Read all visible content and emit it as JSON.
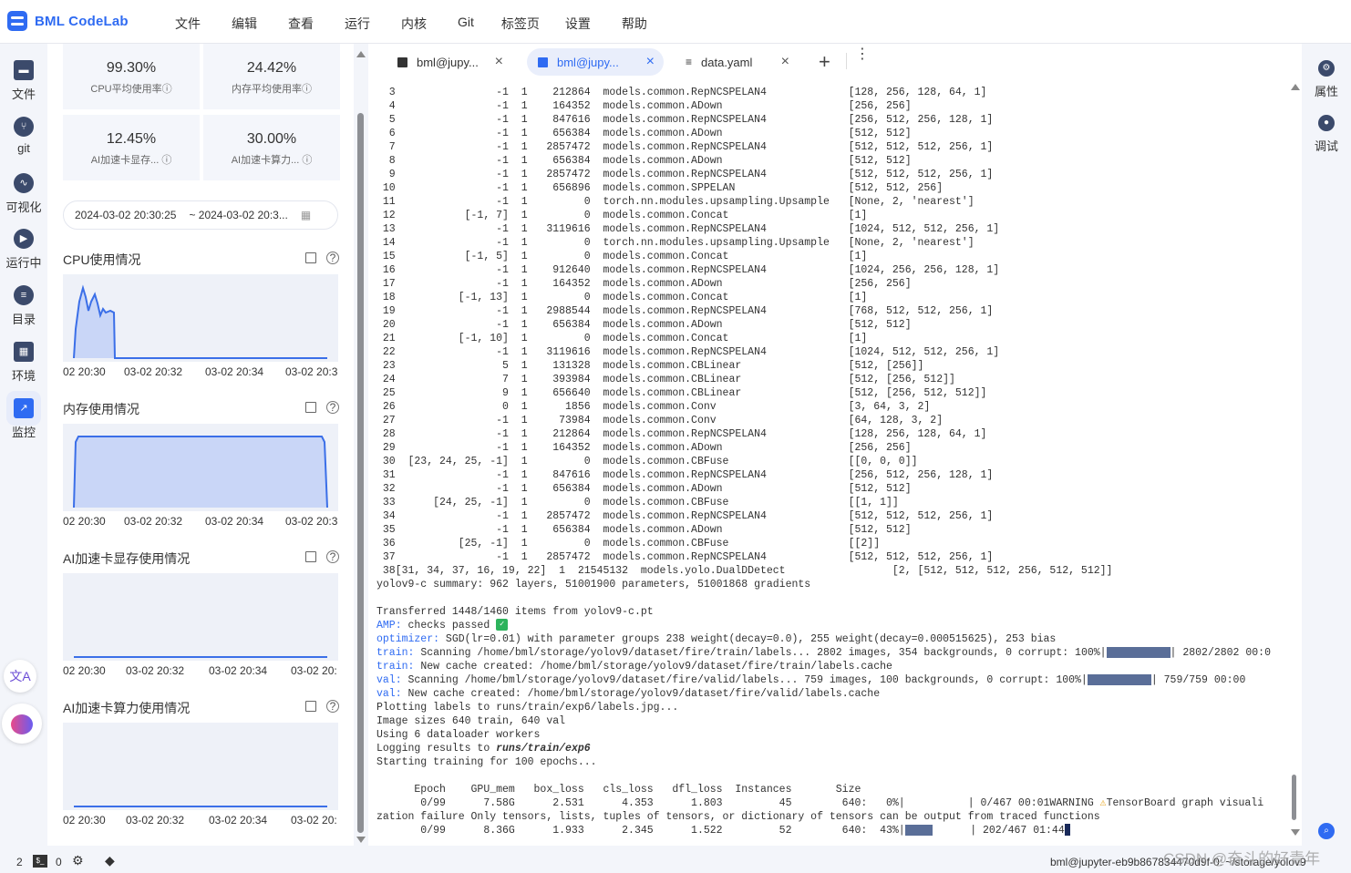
{
  "app": {
    "name": "BML CodeLab"
  },
  "menu": [
    "文件",
    "编辑",
    "查看",
    "运行",
    "内核",
    "Git",
    "标签页",
    "设置",
    "帮助"
  ],
  "activity": [
    {
      "label": "文件",
      "icon": "folder-icon"
    },
    {
      "label": "git",
      "icon": "git-icon"
    },
    {
      "label": "可视化",
      "icon": "visualize-icon"
    },
    {
      "label": "运行中",
      "icon": "running-icon"
    },
    {
      "label": "目录",
      "icon": "toc-icon"
    },
    {
      "label": "环境",
      "icon": "environment-icon"
    },
    {
      "label": "监控",
      "icon": "monitor-icon"
    }
  ],
  "monitor": {
    "stats": [
      {
        "value": "99.30%",
        "label": "CPU平均使用率"
      },
      {
        "value": "24.42%",
        "label": "内存平均使用率"
      },
      {
        "value": "12.45%",
        "label": "AI加速卡显存..."
      },
      {
        "value": "30.00%",
        "label": "AI加速卡算力..."
      }
    ],
    "date_start": "2024-03-02 20:30:25",
    "date_end": "~ 2024-03-02 20:3...",
    "charts": [
      {
        "title": "CPU使用情况",
        "ticks": [
          "02 20:30",
          "03-02 20:32",
          "03-02 20:34",
          "03-02 20:3"
        ]
      },
      {
        "title": "内存使用情况",
        "ticks": [
          "02 20:30",
          "03-02 20:32",
          "03-02 20:34",
          "03-02 20:3"
        ]
      },
      {
        "title": "AI加速卡显存使用情况",
        "ticks": [
          "02 20:30",
          "03-02 20:32",
          "03-02 20:34",
          "03-02 20:"
        ]
      },
      {
        "title": "AI加速卡算力使用情况",
        "ticks": [
          "02 20:30",
          "03-02 20:32",
          "03-02 20:34",
          "03-02 20:"
        ]
      }
    ]
  },
  "tabs": [
    {
      "label": "bml@jupy...",
      "active": false
    },
    {
      "label": "bml@jupy...",
      "active": true
    },
    {
      "label": "data.yaml",
      "active": false
    }
  ],
  "terminal": {
    "model_rows": [
      [
        "3",
        "-1",
        "1",
        "212864",
        "models.common.RepNCSPELAN4",
        "[128, 256, 128, 64, 1]"
      ],
      [
        "4",
        "-1",
        "1",
        "164352",
        "models.common.ADown",
        "[256, 256]"
      ],
      [
        "5",
        "-1",
        "1",
        "847616",
        "models.common.RepNCSPELAN4",
        "[256, 512, 256, 128, 1]"
      ],
      [
        "6",
        "-1",
        "1",
        "656384",
        "models.common.ADown",
        "[512, 512]"
      ],
      [
        "7",
        "-1",
        "1",
        "2857472",
        "models.common.RepNCSPELAN4",
        "[512, 512, 512, 256, 1]"
      ],
      [
        "8",
        "-1",
        "1",
        "656384",
        "models.common.ADown",
        "[512, 512]"
      ],
      [
        "9",
        "-1",
        "1",
        "2857472",
        "models.common.RepNCSPELAN4",
        "[512, 512, 512, 256, 1]"
      ],
      [
        "10",
        "-1",
        "1",
        "656896",
        "models.common.SPPELAN",
        "[512, 512, 256]"
      ],
      [
        "11",
        "-1",
        "1",
        "0",
        "torch.nn.modules.upsampling.Upsample",
        "[None, 2, 'nearest']"
      ],
      [
        "12",
        "[-1, 7]",
        "1",
        "0",
        "models.common.Concat",
        "[1]"
      ],
      [
        "13",
        "-1",
        "1",
        "3119616",
        "models.common.RepNCSPELAN4",
        "[1024, 512, 512, 256, 1]"
      ],
      [
        "14",
        "-1",
        "1",
        "0",
        "torch.nn.modules.upsampling.Upsample",
        "[None, 2, 'nearest']"
      ],
      [
        "15",
        "[-1, 5]",
        "1",
        "0",
        "models.common.Concat",
        "[1]"
      ],
      [
        "16",
        "-1",
        "1",
        "912640",
        "models.common.RepNCSPELAN4",
        "[1024, 256, 256, 128, 1]"
      ],
      [
        "17",
        "-1",
        "1",
        "164352",
        "models.common.ADown",
        "[256, 256]"
      ],
      [
        "18",
        "[-1, 13]",
        "1",
        "0",
        "models.common.Concat",
        "[1]"
      ],
      [
        "19",
        "-1",
        "1",
        "2988544",
        "models.common.RepNCSPELAN4",
        "[768, 512, 512, 256, 1]"
      ],
      [
        "20",
        "-1",
        "1",
        "656384",
        "models.common.ADown",
        "[512, 512]"
      ],
      [
        "21",
        "[-1, 10]",
        "1",
        "0",
        "models.common.Concat",
        "[1]"
      ],
      [
        "22",
        "-1",
        "1",
        "3119616",
        "models.common.RepNCSPELAN4",
        "[1024, 512, 512, 256, 1]"
      ],
      [
        "23",
        "5",
        "1",
        "131328",
        "models.common.CBLinear",
        "[512, [256]]"
      ],
      [
        "24",
        "7",
        "1",
        "393984",
        "models.common.CBLinear",
        "[512, [256, 512]]"
      ],
      [
        "25",
        "9",
        "1",
        "656640",
        "models.common.CBLinear",
        "[512, [256, 512, 512]]"
      ],
      [
        "26",
        "0",
        "1",
        "1856",
        "models.common.Conv",
        "[3, 64, 3, 2]"
      ],
      [
        "27",
        "-1",
        "1",
        "73984",
        "models.common.Conv",
        "[64, 128, 3, 2]"
      ],
      [
        "28",
        "-1",
        "1",
        "212864",
        "models.common.RepNCSPELAN4",
        "[128, 256, 128, 64, 1]"
      ],
      [
        "29",
        "-1",
        "1",
        "164352",
        "models.common.ADown",
        "[256, 256]"
      ],
      [
        "30",
        "[23, 24, 25, -1]",
        "1",
        "0",
        "models.common.CBFuse",
        "[[0, 0, 0]]"
      ],
      [
        "31",
        "-1",
        "1",
        "847616",
        "models.common.RepNCSPELAN4",
        "[256, 512, 256, 128, 1]"
      ],
      [
        "32",
        "-1",
        "1",
        "656384",
        "models.common.ADown",
        "[512, 512]"
      ],
      [
        "33",
        "[24, 25, -1]",
        "1",
        "0",
        "models.common.CBFuse",
        "[[1, 1]]"
      ],
      [
        "34",
        "-1",
        "1",
        "2857472",
        "models.common.RepNCSPELAN4",
        "[512, 512, 512, 256, 1]"
      ],
      [
        "35",
        "-1",
        "1",
        "656384",
        "models.common.ADown",
        "[512, 512]"
      ],
      [
        "36",
        "[25, -1]",
        "1",
        "0",
        "models.common.CBFuse",
        "[[2]]"
      ],
      [
        "37",
        "-1",
        "1",
        "2857472",
        "models.common.RepNCSPELAN4",
        "[512, 512, 512, 256, 1]"
      ]
    ],
    "row38": " 38[31, 34, 37, 16, 19, 22]  1  21545132  models.yolo.DualDDetect                 [2, [512, 512, 512, 256, 512, 512]]",
    "summary": "yolov9-c summary: 962 layers, 51001900 parameters, 51001868 gradients",
    "transferred": "Transferred 1448/1460 items from yolov9-c.pt",
    "amp_key": "AMP:",
    "amp_text": " checks passed ",
    "optimizer_key": "optimizer:",
    "optimizer_text": " SGD(lr=0.01) with parameter groups 238 weight(decay=0.0), 255 weight(decay=0.000515625), 253 bias",
    "train1_key": "train:",
    "train1_text": " Scanning /home/bml/storage/yolov9/dataset/fire/train/labels... 2802 images, 354 backgrounds, 0 corrupt: 100%|",
    "train1_tail": "| 2802/2802 00:0",
    "train2_key": "train:",
    "train2_text": " New cache created: /home/bml/storage/yolov9/dataset/fire/train/labels.cache",
    "val1_key": "val:",
    "val1_text": " Scanning /home/bml/storage/yolov9/dataset/fire/valid/labels... 759 images, 100 backgrounds, 0 corrupt: 100%|",
    "val1_tail": "| 759/759 00:00",
    "val2_key": "val:",
    "val2_text": " New cache created: /home/bml/storage/yolov9/dataset/fire/valid/labels.cache",
    "plotting": "Plotting labels to runs/train/exp6/labels.jpg...",
    "image_sizes": "Image sizes 640 train, 640 val",
    "workers": "Using 6 dataloader workers",
    "logging_prefix": "Logging results to ",
    "logging_path": "runs/train/exp6",
    "starting": "Starting training for 100 epochs...",
    "epoch_header": "      Epoch    GPU_mem   box_loss   cls_loss   dfl_loss  Instances       Size",
    "epoch_row1": "       0/99      7.58G      2.531      4.353      1.803         45        640:   0%|          | 0/467 00:01WARNING ",
    "warning_text": "TensorBoard graph visuali",
    "wrap_line": "zation failure Only tensors, lists, tuples of tensors, or dictionary of tensors can be output from traced functions",
    "epoch_row2": "       0/99      8.36G      1.933      2.345      1.522         52        640:  43%|",
    "epoch_row2_tail": "      | 202/467 01:44",
    "progress": {
      "train_scan": 1.0,
      "val_scan": 1.0,
      "epoch": 0.43
    }
  },
  "rightbar": [
    {
      "label": "属性",
      "icon": "properties-icon"
    },
    {
      "label": "调试",
      "icon": "debug-icon"
    }
  ],
  "status": {
    "count1": "2",
    "count2": "0",
    "path": "bml@jupyter-eb9b867834470d9f-0: ~/storage/yolov9"
  },
  "watermark": "CSDN @奋斗的好青年",
  "colors": {
    "accent": "#2f6bf2",
    "chart_fill": "#c9d6f7",
    "chart_line": "#3b6fe8"
  }
}
